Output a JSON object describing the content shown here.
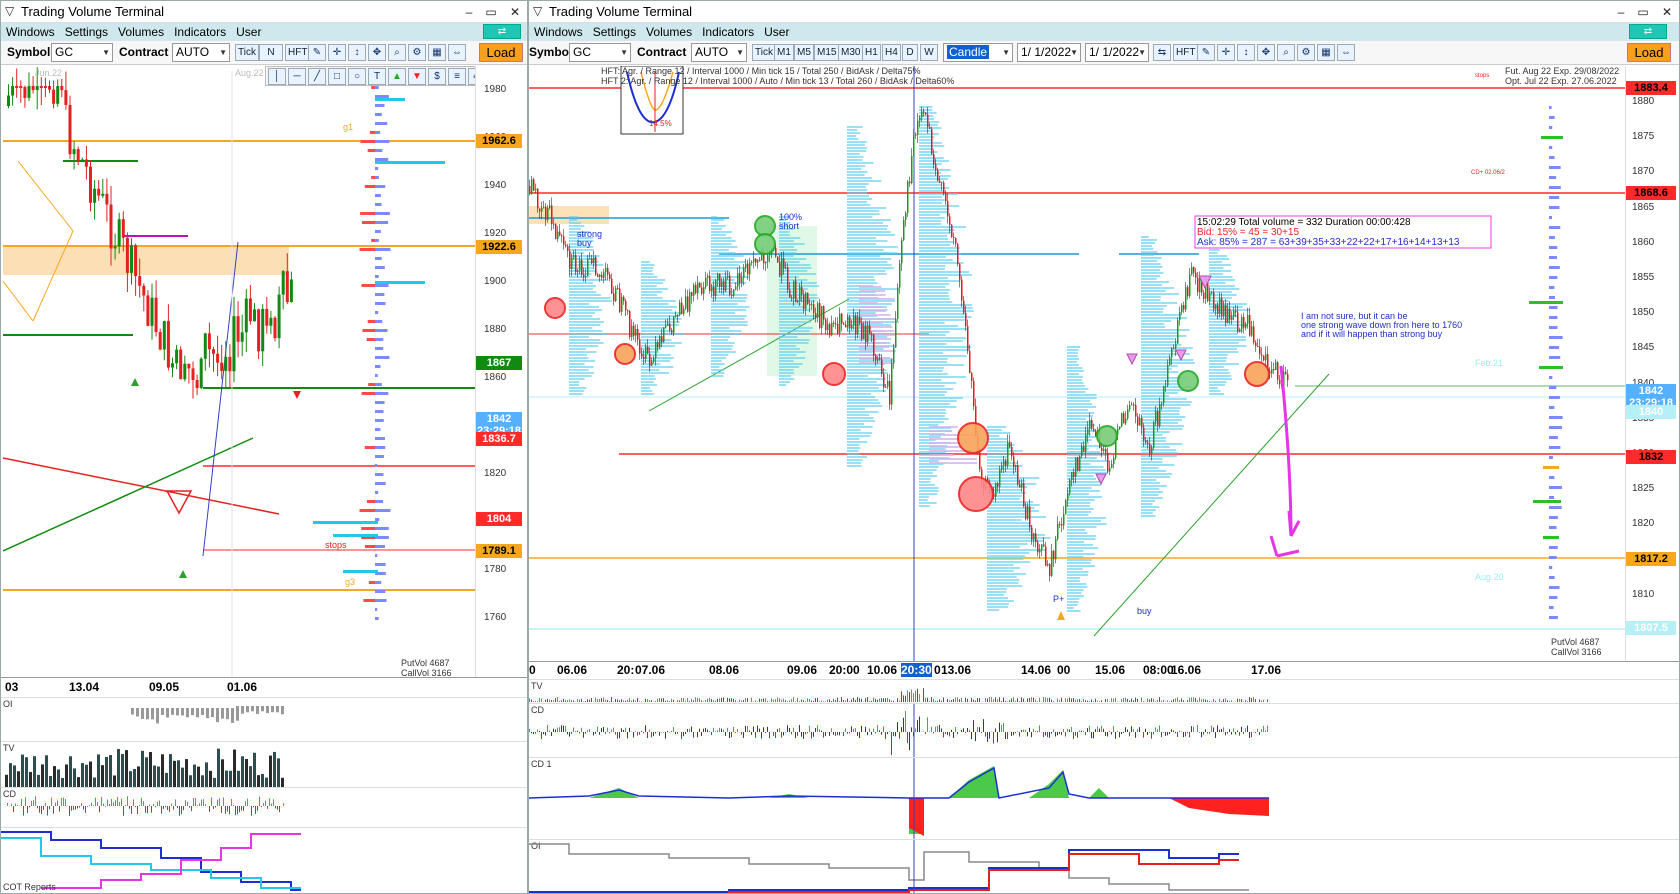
{
  "left": {
    "title": "Trading Volume Terminal",
    "menu": [
      "Windows",
      "Settings",
      "Volumes",
      "Indicators",
      "User"
    ],
    "symbol_label": "Symbol",
    "symbol": "GC",
    "contract_label": "Contract",
    "contract": "AUTO",
    "buttons": {
      "tick": "Tick",
      "n": "N",
      "hft": "HFT"
    },
    "load": "Load",
    "month_labels": [
      "Jun.22",
      "Aug.22"
    ],
    "price_ticks": [
      "1980",
      "1960",
      "1940",
      "1920",
      "1900",
      "1880",
      "1860",
      "1840",
      "1820",
      "1800",
      "1780",
      "1760"
    ],
    "tags": [
      {
        "text": "1962.6",
        "color": "#f7a71d"
      },
      {
        "text": "1922.6",
        "color": "#f7a71d"
      },
      {
        "text": "1867",
        "color": "#118a11"
      },
      {
        "text": "1842",
        "color": "#55b0ff"
      },
      {
        "text": "23:29:18",
        "color": "#55b0ff"
      },
      {
        "text": "1836.7",
        "color": "#ff2a2a"
      },
      {
        "text": "1804",
        "color": "#ff2a2a"
      },
      {
        "text": "1789.1",
        "color": "#f7a71d"
      }
    ],
    "putvol": "PutVol  4687",
    "callvol": "CallVol  3166",
    "date_labels": [
      "03",
      "13.04",
      "09.05",
      "01.06"
    ],
    "sub_labels": [
      "OI",
      "TV",
      "CD"
    ],
    "cot": "COT Reports",
    "level_labels": {
      "stops": "stops",
      "g1": "g1",
      "g3": "g3"
    }
  },
  "right": {
    "title": "Trading Volume Terminal",
    "menu": [
      "Windows",
      "Settings",
      "Volumes",
      "Indicators",
      "User"
    ],
    "symbol_label": "Symbol",
    "symbol": "GC",
    "contract_label": "Contract",
    "contract": "AUTO",
    "tf": [
      "Tick",
      "M1",
      "M5",
      "M15",
      "M30",
      "H1",
      "H4",
      "D",
      "W"
    ],
    "chart_type": "Candle",
    "date1": "1/ 1/2022",
    "date2": "1/ 1/2022",
    "hft": "HFT",
    "load": "Load",
    "hft_line1": "HFT: Agr. / Range 12 / Interval 1000 / Min tick 15 / Total 250 / BidAsk / Delta75%",
    "hft_line2": "HFT 2: Agr. / Range 12 / Interval 1000 / Auto / Min tick 13 / Total 260 / BidAsk / Delta60%",
    "fut": "Fut. Aug 22 Exp. 29/08/2022",
    "opt": "Opt. Jul 22 Exp. 27.06.2022",
    "gauge": "14.5%",
    "price_ticks": [
      "1880",
      "1875",
      "1870",
      "1865",
      "1860",
      "1855",
      "1850",
      "1845",
      "1840",
      "1835",
      "1830",
      "1825",
      "1820",
      "1815",
      "1810",
      "1805"
    ],
    "tags": [
      {
        "text": "1883.4",
        "color": "#ff2a2a"
      },
      {
        "text": "1868.6",
        "color": "#ff2a2a"
      },
      {
        "text": "1842",
        "color": "#55b0ff"
      },
      {
        "text": "23:29:18",
        "color": "#55b0ff"
      },
      {
        "text": "1840",
        "color": "#b5f0f7"
      },
      {
        "text": "1832",
        "color": "#ff2a2a"
      },
      {
        "text": "1817.2",
        "color": "#f7a71d"
      },
      {
        "text": "1807.5",
        "color": "#b5f0f7"
      }
    ],
    "info": {
      "l1": "15:02:29   Total volume = 332   Duration 00:00:428",
      "l2": "Bid: 15% = 45 = 30+15",
      "l3": "Ask: 85% = 287 = 63+39+35+33+22+22+17+16+14+13+13"
    },
    "note": [
      "I am not sure, but it can be",
      "one strong wave down fron here to 1760",
      "and if it will happen than strong buy"
    ],
    "strong_buy": [
      "strong",
      "buy"
    ],
    "short_label": [
      "100%",
      "short"
    ],
    "buy": "buy",
    "p_plus": "P+",
    "feb21": "Feb.21",
    "aug20": "Aug.20",
    "cd_label": "CD+ 02.06/2",
    "stops": "stops",
    "date_labels": [
      "0",
      "06.06",
      "20:",
      "07.06",
      "08.06",
      "09.06",
      "20:00",
      "10.06",
      "20:30",
      "0",
      "13.06",
      "14.06",
      "00",
      "15.06",
      "08:00",
      "16.06",
      "17.06"
    ],
    "putvol": "PutVol  4687",
    "callvol": "CallVol  3166",
    "sub_labels": [
      "TV",
      "CD",
      "CD 1",
      "OI"
    ]
  }
}
